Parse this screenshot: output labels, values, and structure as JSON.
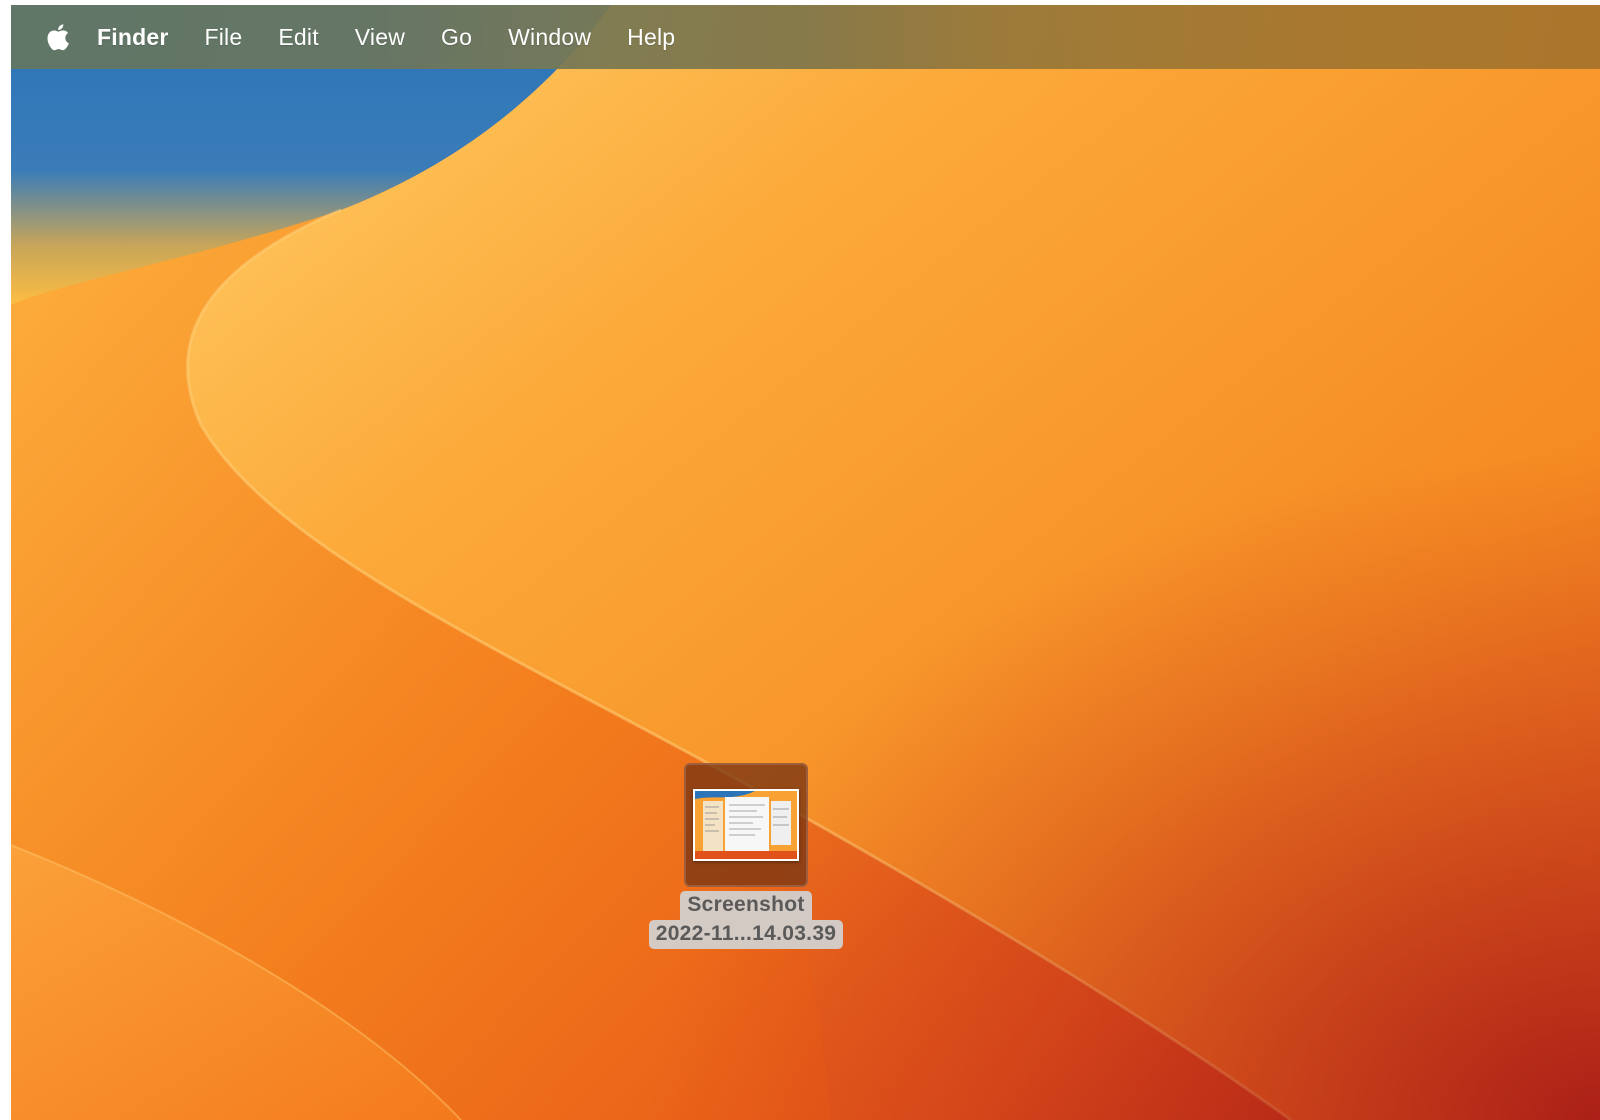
{
  "menubar": {
    "apple_icon": "apple-logo-icon",
    "app_name": "Finder",
    "items": [
      "File",
      "Edit",
      "View",
      "Go",
      "Window",
      "Help"
    ]
  },
  "desktop": {
    "wallpaper": "macOS Ventura orange",
    "colors": {
      "sky_blue": "#2a74b9",
      "light_orange": "#fdb73e",
      "orange": "#f68a1c",
      "deep_red": "#b52319"
    },
    "file": {
      "name_line1": "Screenshot",
      "name_line2": "2022-11...14.03.39",
      "icon": "image-file-thumbnail-icon",
      "selected": true
    }
  }
}
